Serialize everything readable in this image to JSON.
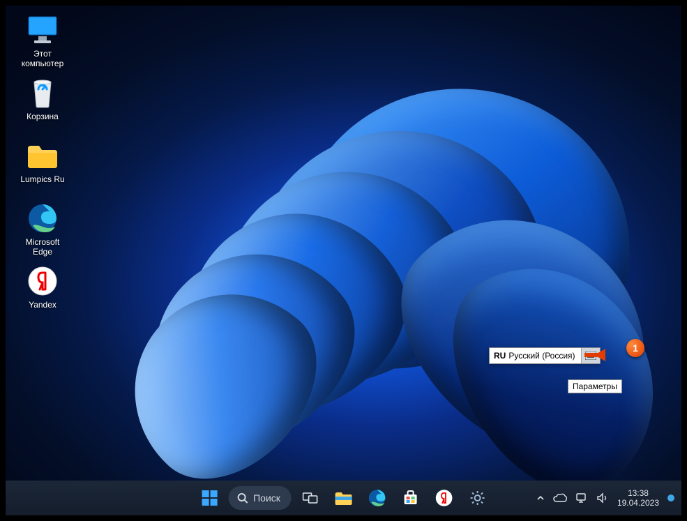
{
  "desktop_icons": [
    {
      "label_line1": "Этот",
      "label_line2": "компьютер"
    },
    {
      "label_line1": "Корзина",
      "label_line2": ""
    },
    {
      "label_line1": "Lumpics Ru",
      "label_line2": ""
    },
    {
      "label_line1": "Microsoft",
      "label_line2": "Edge"
    },
    {
      "label_line1": "Yandex",
      "label_line2": ""
    }
  ],
  "language_flyout": {
    "code": "RU",
    "name": "Русский (Россия)"
  },
  "tooltip": "Параметры",
  "marker": "1",
  "taskbar": {
    "search_label": "Поиск",
    "time": "13:38",
    "date": "19.04.2023"
  }
}
